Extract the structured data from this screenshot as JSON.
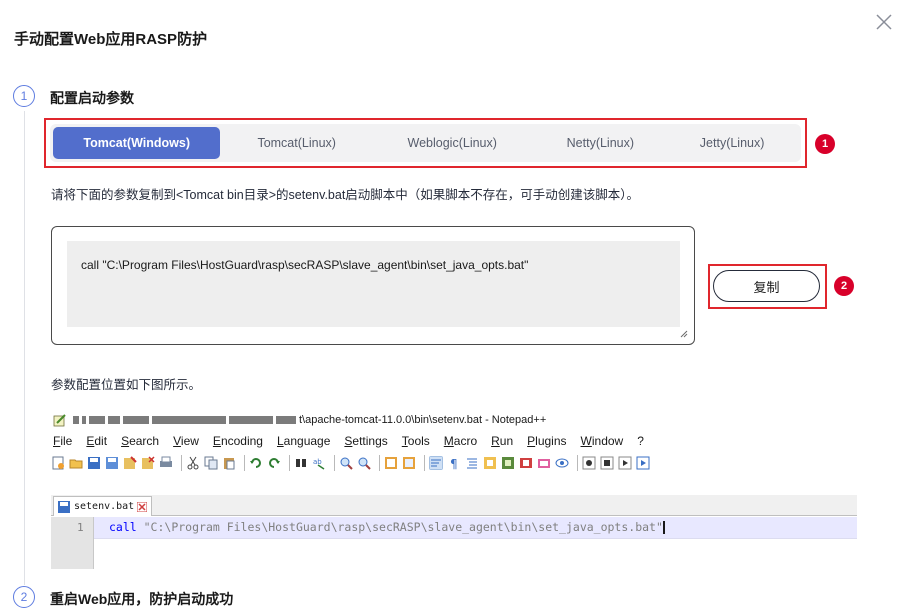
{
  "dialog": {
    "title": "手动配置Web应用RASP防护"
  },
  "steps": [
    {
      "number": "1",
      "title": "配置启动参数"
    },
    {
      "number": "2",
      "title": "重启Web应用，防护启动成功"
    }
  ],
  "tabs": [
    {
      "label": "Tomcat(Windows)",
      "active": true
    },
    {
      "label": "Tomcat(Linux)",
      "active": false
    },
    {
      "label": "Weblogic(Linux)",
      "active": false
    },
    {
      "label": "Netty(Linux)",
      "active": false
    },
    {
      "label": "Jetty(Linux)",
      "active": false
    }
  ],
  "badges": {
    "first": "1",
    "second": "2"
  },
  "description": "请将下面的参数复制到<Tomcat bin目录>的setenv.bat启动脚本中（如果脚本不存在，可手动创建该脚本）。",
  "code": {
    "value": "call \"C:\\Program Files\\HostGuard\\rasp\\secRASP\\slave_agent\\bin\\set_java_opts.bat\""
  },
  "copy_button": "复制",
  "location_text": "参数配置位置如下图所示。",
  "notepad": {
    "title_suffix": "t\\apache-tomcat-11.0.0\\bin\\setenv.bat - Notepad++",
    "menus": [
      "File",
      "Edit",
      "Search",
      "View",
      "Encoding",
      "Language",
      "Settings",
      "Tools",
      "Macro",
      "Run",
      "Plugins",
      "Window",
      "?"
    ],
    "file_tab": "setenv.bat",
    "line_number": "1",
    "code_keyword": "call",
    "code_string": " \"C:\\Program Files\\HostGuard\\rasp\\secRASP\\slave_agent\\bin\\set_java_opts.bat\""
  },
  "colors": {
    "accent": "#526ecc",
    "highlight_border": "#e0262d",
    "badge": "#d8002a",
    "step_circle": "#5e7ce0"
  }
}
